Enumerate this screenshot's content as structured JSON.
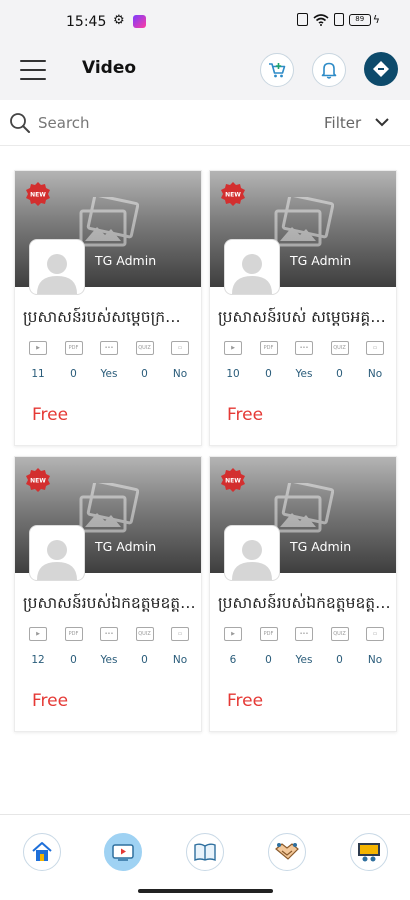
{
  "status_bar": {
    "time": "15:45",
    "battery": "89"
  },
  "header": {
    "title": "Video"
  },
  "search": {
    "placeholder": "Search",
    "filter_label": "Filter"
  },
  "cards": [
    {
      "author": "TG Admin",
      "title": "ប្រសាសន៍របស់សម្តេចក្រឡាហោម",
      "stats": [
        "11",
        "0",
        "Yes",
        "0",
        "No"
      ],
      "price": "Free"
    },
    {
      "author": "TG Admin",
      "title": "ប្រសាសន៍របស់ សម្តេចអគ្គមហា",
      "stats": [
        "10",
        "0",
        "Yes",
        "0",
        "No"
      ],
      "price": "Free"
    },
    {
      "author": "TG Admin",
      "title": "ប្រសាសន៍របស់ឯកឧត្តមឧត្តមសេនីយ៍",
      "stats": [
        "12",
        "0",
        "Yes",
        "0",
        "No"
      ],
      "price": "Free"
    },
    {
      "author": "TG Admin",
      "title": "ប្រសាសន៍របស់ឯកឧត្តមឧត្តមសេនីយ៍",
      "stats": [
        "6",
        "0",
        "Yes",
        "0",
        "No"
      ],
      "price": "Free"
    }
  ],
  "stat_icons": [
    "video-icon",
    "pdf-icon",
    "chat-icon",
    "quiz-icon",
    "certificate-icon"
  ],
  "bottom_nav": [
    "home-icon",
    "video-icon",
    "book-icon",
    "handshake-icon",
    "presentation-icon"
  ],
  "colors": {
    "accent": "#9fd2f3",
    "price": "#e53935",
    "stat_value": "#2a5c7a",
    "badge": "#d32f2f"
  }
}
